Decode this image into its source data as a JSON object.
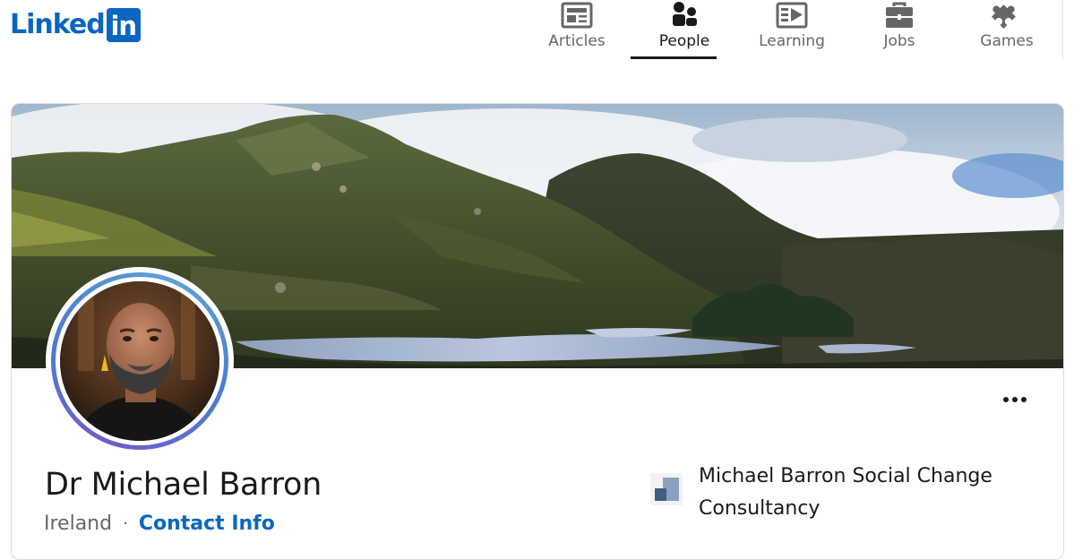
{
  "header": {
    "logo_text": "Linked",
    "logo_box_text": "in",
    "brand_color": "#0a66c2",
    "nav": [
      {
        "label": "Articles",
        "icon": "articles-icon",
        "active": false
      },
      {
        "label": "People",
        "icon": "people-icon",
        "active": true
      },
      {
        "label": "Learning",
        "icon": "learning-icon",
        "active": false
      },
      {
        "label": "Jobs",
        "icon": "briefcase-icon",
        "active": false
      },
      {
        "label": "Games",
        "icon": "puzzle-icon",
        "active": false
      }
    ]
  },
  "profile": {
    "name": "Dr Michael Barron",
    "location": "Ireland",
    "separator": "·",
    "contact_link": "Contact Info",
    "company": "Michael Barron Social Change Consultancy",
    "more_icon": "more-icon"
  }
}
